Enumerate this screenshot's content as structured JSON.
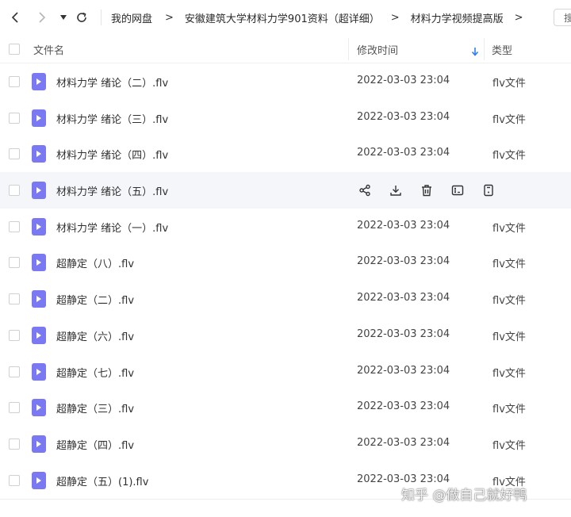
{
  "breadcrumbs": [
    "我的网盘",
    "安徽建筑大学材料力学901资料（超详细）",
    "材料力学视频提高版"
  ],
  "breadcrumb_separator": ">",
  "search": {
    "stub_text": "搜"
  },
  "columns": {
    "name": "文件名",
    "modified": "修改时间",
    "type": "类型"
  },
  "files": [
    {
      "name": "材料力学 绪论（二）.flv",
      "modified": "2022-03-03 23:04",
      "type": "flv文件"
    },
    {
      "name": "材料力学 绪论（三）.flv",
      "modified": "2022-03-03 23:04",
      "type": "flv文件"
    },
    {
      "name": "材料力学 绪论（四）.flv",
      "modified": "2022-03-03 23:04",
      "type": "flv文件"
    },
    {
      "name": "材料力学 绪论（五）.flv",
      "modified": "",
      "type": "",
      "hovered": true
    },
    {
      "name": "材料力学 绪论（一）.flv",
      "modified": "2022-03-03 23:04",
      "type": "flv文件"
    },
    {
      "name": "超静定（八）.flv",
      "modified": "2022-03-03 23:04",
      "type": "flv文件"
    },
    {
      "name": "超静定（二）.flv",
      "modified": "2022-03-03 23:04",
      "type": "flv文件"
    },
    {
      "name": "超静定（六）.flv",
      "modified": "2022-03-03 23:04",
      "type": "flv文件"
    },
    {
      "name": "超静定（七）.flv",
      "modified": "2022-03-03 23:04",
      "type": "flv文件"
    },
    {
      "name": "超静定（三）.flv",
      "modified": "2022-03-03 23:04",
      "type": "flv文件"
    },
    {
      "name": "超静定（四）.flv",
      "modified": "2022-03-03 23:04",
      "type": "flv文件"
    },
    {
      "name": "超静定（五）(1).flv",
      "modified": "2022-03-03 23:04",
      "type": "flv文件"
    }
  ],
  "row_actions": [
    "share-icon",
    "download-icon",
    "delete-icon",
    "rename-icon",
    "more-icon"
  ],
  "watermark": "知乎 @做自己就好鸭",
  "colors": {
    "file_icon": "#7b79f2",
    "sort_arrow": "#2f7cf6",
    "hover_row": "#f5f6fa"
  }
}
